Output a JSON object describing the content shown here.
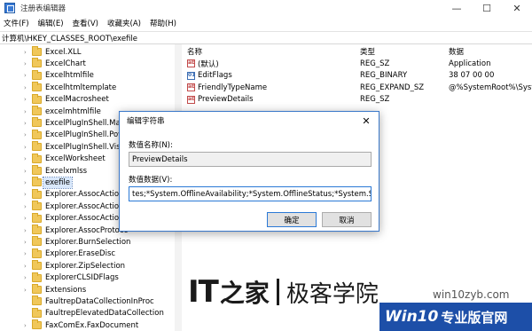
{
  "window": {
    "title": "注册表编辑器",
    "minimize": "—",
    "maximize": "☐",
    "close": "✕"
  },
  "menu": [
    "文件(F)",
    "编辑(E)",
    "查看(V)",
    "收藏夹(A)",
    "帮助(H)"
  ],
  "address": "计算机\\HKEY_CLASSES_ROOT\\exefile",
  "tree": {
    "items": [
      {
        "label": "Excel.XLL",
        "expandable": true
      },
      {
        "label": "ExcelChart",
        "expandable": true
      },
      {
        "label": "Excelhtmlfile",
        "expandable": true
      },
      {
        "label": "Excelhtmltemplate",
        "expandable": true
      },
      {
        "label": "ExcelMacrosheet",
        "expandable": true
      },
      {
        "label": "excelmhtmlfile",
        "expandable": true
      },
      {
        "label": "ExcelPlugInShell.MapE",
        "expandable": true
      },
      {
        "label": "ExcelPlugInShell.Powe",
        "expandable": true
      },
      {
        "label": "ExcelPlugInShell.Visua",
        "expandable": true
      },
      {
        "label": "ExcelWorksheet",
        "expandable": true
      },
      {
        "label": "Excelxmlss",
        "expandable": true
      },
      {
        "label": "exefile",
        "expandable": true,
        "selected": true
      },
      {
        "label": "Explorer.AssocActionId",
        "expandable": true
      },
      {
        "label": "Explorer.AssocActionId",
        "expandable": true
      },
      {
        "label": "Explorer.AssocActionId",
        "expandable": true
      },
      {
        "label": "Explorer.AssocProtoco",
        "expandable": true
      },
      {
        "label": "Explorer.BurnSelection",
        "expandable": true
      },
      {
        "label": "Explorer.EraseDisc",
        "expandable": true
      },
      {
        "label": "Explorer.ZipSelection",
        "expandable": true
      },
      {
        "label": "ExplorerCLSIDFlags",
        "expandable": true
      },
      {
        "label": "Extensions",
        "expandable": true
      },
      {
        "label": "FaultrepDataCollectionInProc",
        "expandable": false
      },
      {
        "label": "FaultrepElevatedDataCollection",
        "expandable": false
      },
      {
        "label": "FaxComEx.FaxDocument",
        "expandable": true
      }
    ]
  },
  "list": {
    "headers": {
      "name": "名称",
      "type": "类型",
      "data": "数据"
    },
    "rows": [
      {
        "icon": "string-value-icon",
        "kind": "sz",
        "name": "(默认)",
        "type": "REG_SZ",
        "data": "Application"
      },
      {
        "icon": "binary-value-icon",
        "kind": "bin",
        "name": "EditFlags",
        "type": "REG_BINARY",
        "data": "38 07 00 00"
      },
      {
        "icon": "string-value-icon",
        "kind": "sz",
        "name": "FriendlyTypeName",
        "type": "REG_EXPAND_SZ",
        "data": "@%SystemRoot%\\System"
      },
      {
        "icon": "string-value-icon",
        "kind": "sz",
        "name": "PreviewDetails",
        "type": "REG_SZ",
        "data": ""
      }
    ]
  },
  "dialog": {
    "title": "编辑字符串",
    "close": "✕",
    "name_label": "数值名称(N):",
    "name_value": "PreviewDetails",
    "data_label": "数值数据(V):",
    "data_value": "tes;*System.OfflineAvailability;*System.OfflineStatus;*System.SharedWith",
    "ok": "确定",
    "cancel": "取消"
  },
  "watermark": {
    "it": "IT",
    "zhi": "之家",
    "brand": "极客学院",
    "url": "win10zyb.com",
    "badge_en": "Win10",
    "badge_cn": "专业版官网"
  }
}
